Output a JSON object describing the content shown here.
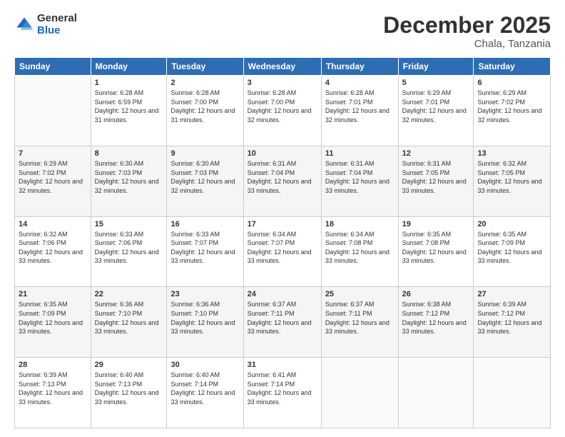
{
  "logo": {
    "general": "General",
    "blue": "Blue"
  },
  "header": {
    "month": "December 2025",
    "location": "Chala, Tanzania"
  },
  "weekdays": [
    "Sunday",
    "Monday",
    "Tuesday",
    "Wednesday",
    "Thursday",
    "Friday",
    "Saturday"
  ],
  "weeks": [
    [
      {
        "day": "",
        "sunrise": "",
        "sunset": "",
        "daylight": ""
      },
      {
        "day": "1",
        "sunrise": "Sunrise: 6:28 AM",
        "sunset": "Sunset: 6:59 PM",
        "daylight": "Daylight: 12 hours and 31 minutes."
      },
      {
        "day": "2",
        "sunrise": "Sunrise: 6:28 AM",
        "sunset": "Sunset: 7:00 PM",
        "daylight": "Daylight: 12 hours and 31 minutes."
      },
      {
        "day": "3",
        "sunrise": "Sunrise: 6:28 AM",
        "sunset": "Sunset: 7:00 PM",
        "daylight": "Daylight: 12 hours and 32 minutes."
      },
      {
        "day": "4",
        "sunrise": "Sunrise: 6:28 AM",
        "sunset": "Sunset: 7:01 PM",
        "daylight": "Daylight: 12 hours and 32 minutes."
      },
      {
        "day": "5",
        "sunrise": "Sunrise: 6:29 AM",
        "sunset": "Sunset: 7:01 PM",
        "daylight": "Daylight: 12 hours and 32 minutes."
      },
      {
        "day": "6",
        "sunrise": "Sunrise: 6:29 AM",
        "sunset": "Sunset: 7:02 PM",
        "daylight": "Daylight: 12 hours and 32 minutes."
      }
    ],
    [
      {
        "day": "7",
        "sunrise": "Sunrise: 6:29 AM",
        "sunset": "Sunset: 7:02 PM",
        "daylight": "Daylight: 12 hours and 32 minutes."
      },
      {
        "day": "8",
        "sunrise": "Sunrise: 6:30 AM",
        "sunset": "Sunset: 7:03 PM",
        "daylight": "Daylight: 12 hours and 32 minutes."
      },
      {
        "day": "9",
        "sunrise": "Sunrise: 6:30 AM",
        "sunset": "Sunset: 7:03 PM",
        "daylight": "Daylight: 12 hours and 32 minutes."
      },
      {
        "day": "10",
        "sunrise": "Sunrise: 6:31 AM",
        "sunset": "Sunset: 7:04 PM",
        "daylight": "Daylight: 12 hours and 33 minutes."
      },
      {
        "day": "11",
        "sunrise": "Sunrise: 6:31 AM",
        "sunset": "Sunset: 7:04 PM",
        "daylight": "Daylight: 12 hours and 33 minutes."
      },
      {
        "day": "12",
        "sunrise": "Sunrise: 6:31 AM",
        "sunset": "Sunset: 7:05 PM",
        "daylight": "Daylight: 12 hours and 33 minutes."
      },
      {
        "day": "13",
        "sunrise": "Sunrise: 6:32 AM",
        "sunset": "Sunset: 7:05 PM",
        "daylight": "Daylight: 12 hours and 33 minutes."
      }
    ],
    [
      {
        "day": "14",
        "sunrise": "Sunrise: 6:32 AM",
        "sunset": "Sunset: 7:06 PM",
        "daylight": "Daylight: 12 hours and 33 minutes."
      },
      {
        "day": "15",
        "sunrise": "Sunrise: 6:33 AM",
        "sunset": "Sunset: 7:06 PM",
        "daylight": "Daylight: 12 hours and 33 minutes."
      },
      {
        "day": "16",
        "sunrise": "Sunrise: 6:33 AM",
        "sunset": "Sunset: 7:07 PM",
        "daylight": "Daylight: 12 hours and 33 minutes."
      },
      {
        "day": "17",
        "sunrise": "Sunrise: 6:34 AM",
        "sunset": "Sunset: 7:07 PM",
        "daylight": "Daylight: 12 hours and 33 minutes."
      },
      {
        "day": "18",
        "sunrise": "Sunrise: 6:34 AM",
        "sunset": "Sunset: 7:08 PM",
        "daylight": "Daylight: 12 hours and 33 minutes."
      },
      {
        "day": "19",
        "sunrise": "Sunrise: 6:35 AM",
        "sunset": "Sunset: 7:08 PM",
        "daylight": "Daylight: 12 hours and 33 minutes."
      },
      {
        "day": "20",
        "sunrise": "Sunrise: 6:35 AM",
        "sunset": "Sunset: 7:09 PM",
        "daylight": "Daylight: 12 hours and 33 minutes."
      }
    ],
    [
      {
        "day": "21",
        "sunrise": "Sunrise: 6:35 AM",
        "sunset": "Sunset: 7:09 PM",
        "daylight": "Daylight: 12 hours and 33 minutes."
      },
      {
        "day": "22",
        "sunrise": "Sunrise: 6:36 AM",
        "sunset": "Sunset: 7:10 PM",
        "daylight": "Daylight: 12 hours and 33 minutes."
      },
      {
        "day": "23",
        "sunrise": "Sunrise: 6:36 AM",
        "sunset": "Sunset: 7:10 PM",
        "daylight": "Daylight: 12 hours and 33 minutes."
      },
      {
        "day": "24",
        "sunrise": "Sunrise: 6:37 AM",
        "sunset": "Sunset: 7:11 PM",
        "daylight": "Daylight: 12 hours and 33 minutes."
      },
      {
        "day": "25",
        "sunrise": "Sunrise: 6:37 AM",
        "sunset": "Sunset: 7:11 PM",
        "daylight": "Daylight: 12 hours and 33 minutes."
      },
      {
        "day": "26",
        "sunrise": "Sunrise: 6:38 AM",
        "sunset": "Sunset: 7:12 PM",
        "daylight": "Daylight: 12 hours and 33 minutes."
      },
      {
        "day": "27",
        "sunrise": "Sunrise: 6:39 AM",
        "sunset": "Sunset: 7:12 PM",
        "daylight": "Daylight: 12 hours and 33 minutes."
      }
    ],
    [
      {
        "day": "28",
        "sunrise": "Sunrise: 6:39 AM",
        "sunset": "Sunset: 7:13 PM",
        "daylight": "Daylight: 12 hours and 33 minutes."
      },
      {
        "day": "29",
        "sunrise": "Sunrise: 6:40 AM",
        "sunset": "Sunset: 7:13 PM",
        "daylight": "Daylight: 12 hours and 33 minutes."
      },
      {
        "day": "30",
        "sunrise": "Sunrise: 6:40 AM",
        "sunset": "Sunset: 7:14 PM",
        "daylight": "Daylight: 12 hours and 33 minutes."
      },
      {
        "day": "31",
        "sunrise": "Sunrise: 6:41 AM",
        "sunset": "Sunset: 7:14 PM",
        "daylight": "Daylight: 12 hours and 33 minutes."
      },
      {
        "day": "",
        "sunrise": "",
        "sunset": "",
        "daylight": ""
      },
      {
        "day": "",
        "sunrise": "",
        "sunset": "",
        "daylight": ""
      },
      {
        "day": "",
        "sunrise": "",
        "sunset": "",
        "daylight": ""
      }
    ]
  ]
}
